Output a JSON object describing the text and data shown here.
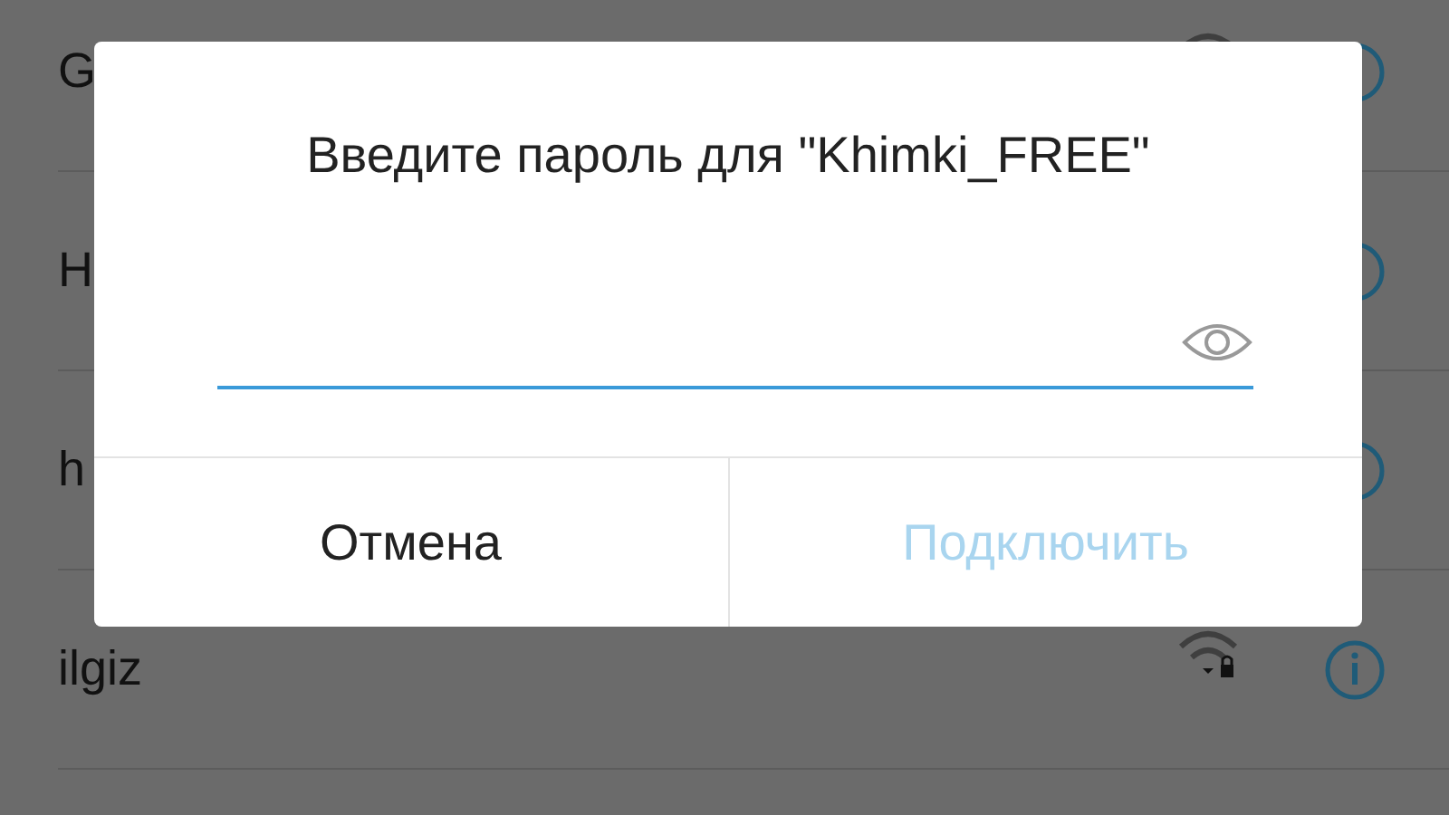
{
  "networks": [
    {
      "name": "G"
    },
    {
      "name": "H"
    },
    {
      "name": "h"
    },
    {
      "name": "ilgiz",
      "locked": true
    }
  ],
  "dialog": {
    "title": "Введите пароль для \"Khimki_FREE\"",
    "password_field": {
      "focused": true
    },
    "buttons": [
      {
        "label": "Отмена",
        "disabled": false
      },
      {
        "label": "Подключить",
        "disabled": true
      }
    ]
  }
}
